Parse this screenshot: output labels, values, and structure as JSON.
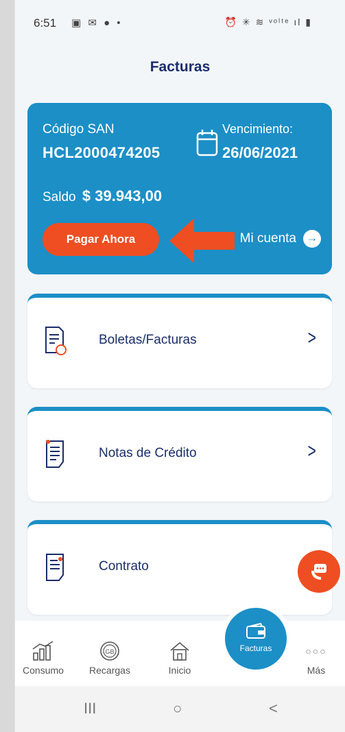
{
  "status_bar": {
    "time": "6:51",
    "left_icons": "▣ ✉ ● •",
    "right_icons": "⏰ ✳ ≋ ᵛᵒˡᵗᵉ ıl ▮"
  },
  "page_title": "Facturas",
  "account": {
    "code_label": "Código SAN",
    "code_value": "HCL2000474205",
    "due_label": "Vencimiento:",
    "due_value": "26/06/2021",
    "balance_label": "Saldo",
    "balance_value": "$ 39.943,00",
    "pay_button": "Pagar Ahora",
    "account_link": "Mi cuenta",
    "arrow_color": "#ee4e22"
  },
  "menu": [
    {
      "label": "Boletas/Facturas",
      "icon": "invoice-icon"
    },
    {
      "label": "Notas de Crédito",
      "icon": "credit-note-icon"
    },
    {
      "label": "Contrato",
      "icon": "contract-icon"
    }
  ],
  "bottom_nav": {
    "items": [
      {
        "label": "Consumo",
        "icon": "chart-icon"
      },
      {
        "label": "Recargas",
        "icon": "gb-icon"
      },
      {
        "label": "Inicio",
        "icon": "home-icon"
      },
      {
        "label": "Facturas",
        "icon": "wallet-icon",
        "active": true
      },
      {
        "label": "Más",
        "icon": "more-icon"
      }
    ]
  },
  "system_nav": {
    "recent": "III",
    "home": "○",
    "back": "<"
  },
  "colors": {
    "brand_blue": "#1c8fc7",
    "accent_orange": "#ee4e22",
    "title_navy": "#1b2d6b"
  }
}
